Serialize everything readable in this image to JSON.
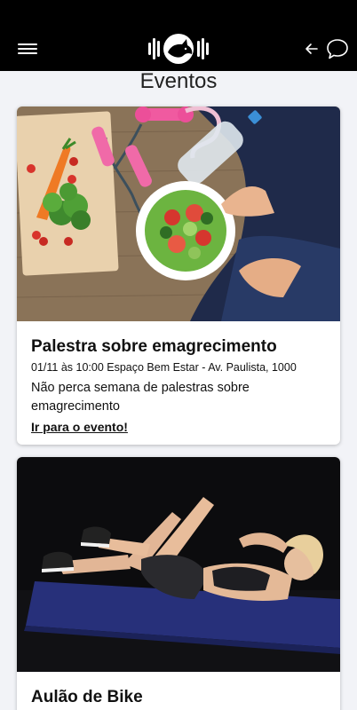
{
  "header": {
    "menu_icon": "hamburger-menu-icon",
    "logo_icon": "rhino-logo-icon",
    "back_icon": "arrow-left-icon",
    "chat_icon": "chat-bubble-icon",
    "bar_color": "#000000"
  },
  "page": {
    "title": "Eventos",
    "background": "#f2f3f7"
  },
  "events": [
    {
      "title": "Palestra sobre emagrecimento",
      "meta": "01/11 às 10:00 Espaço Bem Estar - Av. Paulista, 1000",
      "description": "Não perca semana de palestras sobre emagrecimento",
      "link": "Ir para o evento!"
    },
    {
      "title": "Aulão de Bike"
    }
  ]
}
